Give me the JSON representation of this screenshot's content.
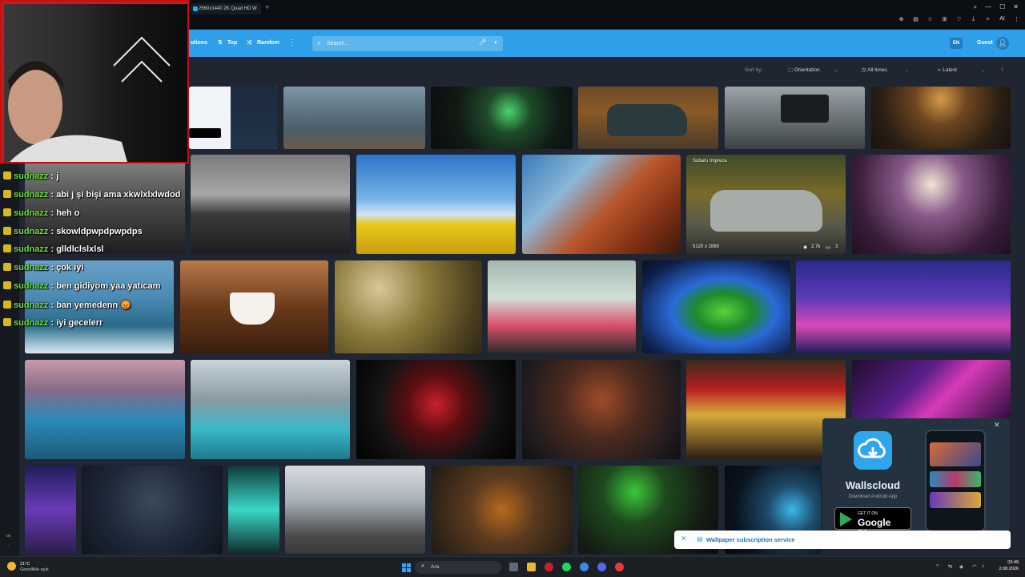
{
  "browser": {
    "tab_title": "2560x1440 2K Quad HD W",
    "new_tab": "+",
    "toolbar_text": "AI"
  },
  "site": {
    "nav": {
      "solutions": "utions",
      "top": "Top",
      "random": "Random"
    },
    "search_placeholder": "Search...",
    "lang": "EN",
    "guest": "Guest"
  },
  "filters": {
    "sort_by": "Sort by:",
    "orientation": "Orientation",
    "time": "All times",
    "order": "Latest"
  },
  "gallery": {
    "featured": {
      "title": "Subaru Impreza",
      "resolution": "5120 x 2880",
      "views": "2.7k",
      "likes": "3"
    }
  },
  "chat": [
    {
      "user": "sudnazz",
      "msg": ": j"
    },
    {
      "user": "sudnazz",
      "msg": ": abi j şi bişi ama xkwlxlxlwdod"
    },
    {
      "user": "sudnazz",
      "msg": ": heh o"
    },
    {
      "user": "sudnazz",
      "msg": ": skowldpwpdpwpdps"
    },
    {
      "user": "sudnazz",
      "msg": ": glldlclslxlsl"
    },
    {
      "user": "sudnazz",
      "msg": ": çok iyi"
    },
    {
      "user": "sudnazz",
      "msg": ": ben gidiyom yaa yatıcam"
    },
    {
      "user": "sudnazz",
      "msg": ": ban yemedenn 😡"
    },
    {
      "user": "sudnazz",
      "msg": ": iyi gecelerr"
    }
  ],
  "promo": {
    "app_name": "Wallscloud",
    "subtitle": "Download Android App",
    "store_top": "GET IT ON",
    "store_name": "Google Play"
  },
  "notification": {
    "text": "Wallpaper subscription service"
  },
  "taskbar": {
    "temperature": "21°C",
    "weather": "Genellikle açık",
    "search": "Ara",
    "time": "03:49",
    "date": "2.08.2026"
  },
  "left_strip": {
    "label": "ox"
  },
  "colors": {
    "accent": "#2e9fe8",
    "bg": "#1f2631",
    "chat_user": "#6fe13a"
  }
}
